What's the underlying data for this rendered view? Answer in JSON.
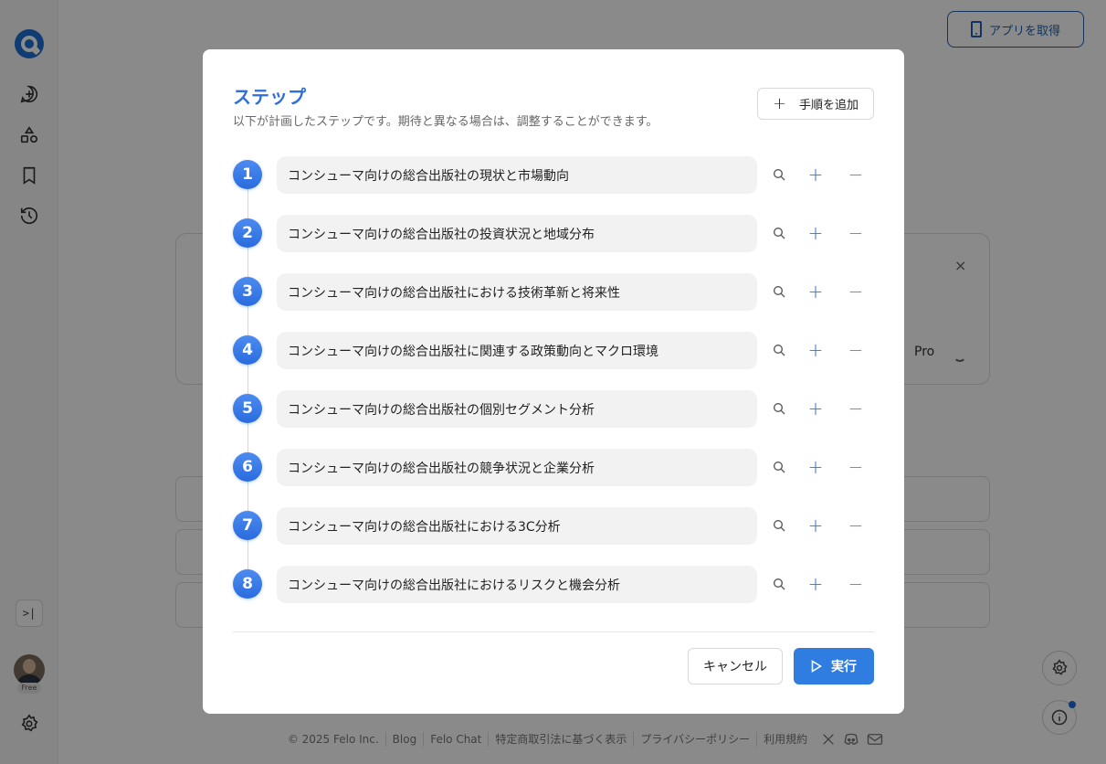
{
  "header": {
    "get_app_label": "アプリを取得"
  },
  "sidebar": {
    "icons": [
      "logo-icon",
      "new-chat-icon",
      "topics-icon",
      "bookmark-icon",
      "history-icon"
    ],
    "expand_label": ">|",
    "plan_badge": "Free"
  },
  "background": {
    "pro_label": "Pro",
    "close_label": "×"
  },
  "footer": {
    "copyright": "© 2025  Felo Inc.",
    "links": [
      "Blog",
      "Felo Chat",
      "特定商取引法に基づく表示",
      "プライバシーポリシー",
      "利用規約"
    ]
  },
  "modal": {
    "title": "ステップ",
    "subtitle": "以下が計画したステップです。期待と異なる場合は、調整することができます。",
    "add_step_label": "手順を追加",
    "add_step_icon": "+",
    "steps": [
      {
        "number": "1",
        "text": "コンシューマ向けの総合出版社の現状と市場動向"
      },
      {
        "number": "2",
        "text": "コンシューマ向けの総合出版社の投資状況と地域分布"
      },
      {
        "number": "3",
        "text": "コンシューマ向けの総合出版社における技術革新と将来性"
      },
      {
        "number": "4",
        "text": "コンシューマ向けの総合出版社に関連する政策動向とマクロ環境"
      },
      {
        "number": "5",
        "text": "コンシューマ向けの総合出版社の個別セグメント分析"
      },
      {
        "number": "6",
        "text": "コンシューマ向けの総合出版社の競争状況と企業分析"
      },
      {
        "number": "7",
        "text": "コンシューマ向けの総合出版社における3C分析"
      },
      {
        "number": "8",
        "text": "コンシューマ向けの総合出版社におけるリスクと機会分析"
      }
    ],
    "step_actions": {
      "plus": "+",
      "minus": "−"
    },
    "cancel_label": "キャンセル",
    "run_label": "実行"
  },
  "colors": {
    "accent": "#2f6fdb",
    "run_button": "#2f7de1",
    "remove": "#e53935",
    "overlay": "rgba(0,0,0,0.46)"
  }
}
